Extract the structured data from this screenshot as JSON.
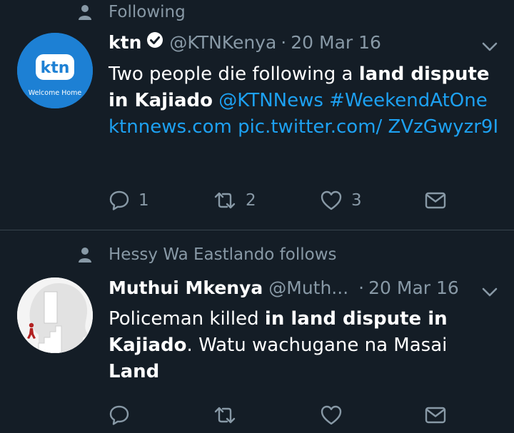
{
  "tweets": [
    {
      "social_context": "Following",
      "avatar_text": "ktn",
      "avatar_subtext": "Welcome Home",
      "name": "ktn",
      "handle": "@KTNKenya",
      "separator": "·",
      "date": "20 Mar 16",
      "verified": true,
      "body": {
        "p1": "Two people die following a ",
        "b1": "land dispute",
        "p2": " ",
        "b2": "in Kajiado",
        "p3": " ",
        "l1": "@KTNNews #WeekendAtOne ktnnews.com pic.twitter.com/ ZVzGwyzr9I"
      },
      "actions": {
        "reply": "1",
        "retweet": "2",
        "like": "3"
      }
    },
    {
      "social_context": "Hessy Wa Eastlando follows",
      "name": "Muthui Mkenya",
      "handle": "@Muth...",
      "separator": "·",
      "date": "20 Mar 16",
      "verified": false,
      "body": {
        "p1": "Policeman killed ",
        "b1": "in land dispute in Kajiado",
        "p2": ". Watu wachugane na Masai ",
        "b2": "Land"
      },
      "actions": {
        "reply": "",
        "retweet": "",
        "like": ""
      }
    }
  ],
  "icons": [
    "person-icon",
    "verified-badge-icon",
    "chevron-down-icon",
    "reply-icon",
    "retweet-icon",
    "like-icon",
    "direct-message-icon"
  ],
  "colors": {
    "background": "#141d26",
    "link": "#1da1f2",
    "muted": "#8899a6",
    "divider": "#38444d"
  }
}
